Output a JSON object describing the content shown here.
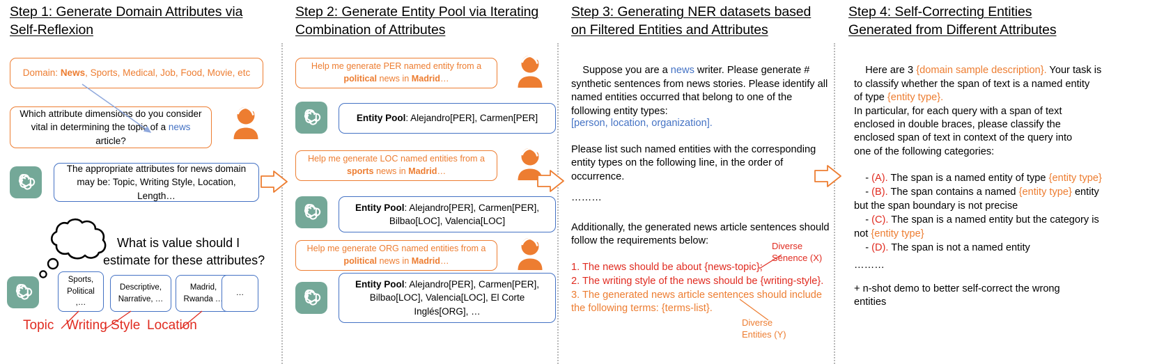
{
  "steps": [
    {
      "title_line1": "Step 1: Generate Domain Attributes via",
      "title_line2": "Self-Reflexion"
    },
    {
      "title_line1": "Step 2: Generate Entity Pool via Iterating",
      "title_line2": "Combination of Attributes"
    },
    {
      "title_line1": "Step 3: Generating NER datasets based",
      "title_line2": "on Filtered Entities and Attributes"
    },
    {
      "title_line1": "Step 4: Self-Correcting Entities",
      "title_line2": "Generated from Different Attributes"
    }
  ],
  "step1": {
    "domain_bubble": {
      "prefix": "Domain: ",
      "bold": "News",
      "rest": ", Sports, Medical, Job, Food, Movie, etc"
    },
    "user_question": {
      "line1": "Which attribute dimensions do you consider",
      "line2_a": "vital in determining the topic of a ",
      "line2_highlight": "news",
      "line2_b": " article?"
    },
    "gpt_answer": {
      "line1": "The appropriate attributes for news domain",
      "line2": "may be: Topic, Writing Style, Location, Length…"
    },
    "thought": {
      "line1": "What is value should I",
      "line2": "estimate for these attributes?"
    },
    "chips": [
      {
        "line1": "Sports,",
        "line2": "Political",
        "line3": ",…"
      },
      {
        "line1": "Descriptive,",
        "line2": "Narrative, …",
        "line3": ""
      },
      {
        "line1": "Madrid,",
        "line2": "Rwanda …",
        "line3": ""
      },
      {
        "line1": "…",
        "line2": "",
        "line3": ""
      }
    ],
    "chip_labels": [
      "Topic",
      "Writing Style",
      "Location"
    ]
  },
  "step2": {
    "prompts": [
      {
        "line1": "Help me generate PER named entity from a",
        "bold1": "political",
        "mid": " news in ",
        "bold2": "Madrid",
        "tail": "…"
      },
      {
        "line1": "Help me generate LOC named entities from a",
        "bold1": "sports",
        "mid": " news in ",
        "bold2": "Madrid",
        "tail": "…"
      },
      {
        "line1": "Help me generate ORG named entities from a",
        "bold1": "political",
        "mid": " news in ",
        "bold2": "Madrid",
        "tail": "…"
      }
    ],
    "responses": [
      {
        "label": "Entity Pool",
        "line1": ": Alejandro[PER], Carmen[PER]",
        "line2": "",
        "line3": ""
      },
      {
        "label": "Entity Pool",
        "line1": ": Alejandro[PER], Carmen[PER],",
        "line2": "Bilbao[LOC], Valencia[LOC]",
        "line3": ""
      },
      {
        "label": "Entity Pool",
        "line1": ": Alejandro[PER], Carmen[PER],",
        "line2": "Bilbao[LOC], Valencia[LOC], El Corte",
        "line3": "Inglés[ORG], …"
      }
    ]
  },
  "step3": {
    "p1_a": "Suppose you are a ",
    "p1_highlight": "news",
    "p1_b": " writer. Please generate #\nsynthetic sentences from news stories. Please identify all\nnamed entities occurred that belong to one of the\nfollowing entity types:",
    "entity_types": "[person, location, organization].",
    "p2": "Please list such named entities with the corresponding\nentity types on the following line, in the order of\noccurrence.",
    "ellipsis": "………",
    "p3": "Additionally, the generated news article sentences should\nfollow the requirements below:",
    "req1": "1. The news should be about {news-topic};",
    "req2": "2. The writing style of the news should be {writing-style}.",
    "req3": "3. The generated news article sentences should include\nthe following terms: {terms-list}.",
    "callout_x": {
      "line1": "Diverse",
      "line2": "Senence (X)"
    },
    "callout_y": {
      "line1": "Diverse",
      "line2": "Entities (Y)"
    }
  },
  "step4": {
    "intro_a": "Here are 3 ",
    "intro_orange1": "{domain sample description}.",
    "intro_b": " Your task is\nto classify whether the span of text is a named entity\nof type ",
    "intro_orange2": "{entity type}.",
    "intro_c": "\nIn particular, for each query with a span of text\nenclosed in double braces, please classify the\nenclosed span of text in context of the query into\none of the following categories:",
    "options": [
      {
        "dash": "- ",
        "key": "(A).",
        "text_a": " The span is a named entity of type ",
        "orange": "{entity type}",
        "text_b": ""
      },
      {
        "dash": "- ",
        "key": "(B).",
        "text_a": " The span contains a named ",
        "orange": "{entity type}",
        "text_b": " entity\nbut the span boundary is not precise"
      },
      {
        "dash": "- ",
        "key": "(C).",
        "text_a": " The span is a named entity but the category is\nnot ",
        "orange": "{entity type}",
        "text_b": ""
      },
      {
        "dash": "- ",
        "key": "(D).",
        "text_a": " The span is not a named entity",
        "orange": "",
        "text_b": ""
      }
    ],
    "ellipsis": "………",
    "footer": "+ n-shot demo to better self-correct the wrong\nentities"
  },
  "colors": {
    "orange": "#ED7D31",
    "blue": "#4472C4",
    "red": "#E02B20",
    "gpt_green": "#74A898",
    "divider": "#b8b8b8"
  }
}
